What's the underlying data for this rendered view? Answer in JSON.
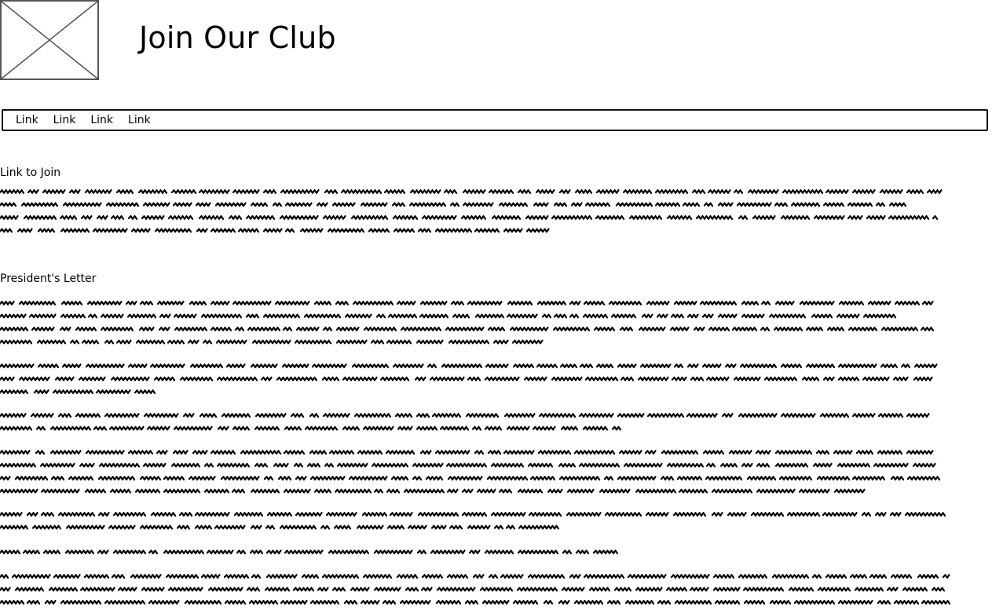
{
  "header": {
    "logo_icon": "image-placeholder-icon",
    "title": "Join Our Club"
  },
  "nav": {
    "links": [
      "Link",
      "Link",
      "Link",
      "Link"
    ]
  },
  "sections": [
    {
      "heading": "Link to Join"
    },
    {
      "heading": "President's Letter"
    }
  ],
  "colors": {
    "text": "#000000",
    "border": "#111111",
    "placeholder": "#555555"
  }
}
